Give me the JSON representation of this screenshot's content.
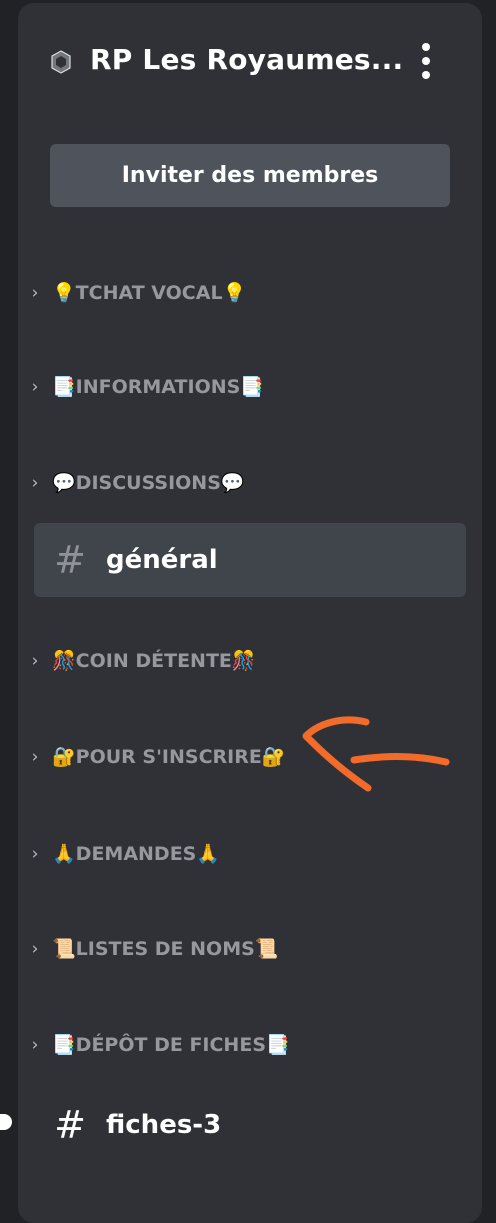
{
  "server": {
    "title": "RP Les Royaumes...",
    "icon": "server-settings-icon",
    "menu_icon": "kebab-menu-icon"
  },
  "invite_button": {
    "label": "Inviter des membres"
  },
  "categories": [
    {
      "emoji_left": "💡",
      "label": "TCHAT VOCAL",
      "emoji_right": "💡"
    },
    {
      "emoji_left": "📑",
      "label": "INFORMATIONS",
      "emoji_right": "📑"
    },
    {
      "emoji_left": "💬",
      "label": "DISCUSSIONS",
      "emoji_right": "💬"
    },
    {
      "emoji_left": "🎊",
      "label": "COIN DÉTENTE",
      "emoji_right": "🎊"
    },
    {
      "emoji_left": "🔐",
      "label": "POUR S'INSCRIRE",
      "emoji_right": "🔐"
    },
    {
      "emoji_left": "🙏",
      "label": "DEMANDES",
      "emoji_right": "🙏"
    },
    {
      "emoji_left": "📜",
      "label": "LISTES DE NOMS",
      "emoji_right": "📜"
    },
    {
      "emoji_left": "📑",
      "label": "DÉPÔT DE FICHES",
      "emoji_right": "📑"
    }
  ],
  "channels": {
    "active": {
      "hash": "#",
      "name": "général"
    },
    "unread": {
      "hash": "#",
      "name": "fiches-3"
    }
  },
  "colors": {
    "background": "#202225",
    "panel": "#2f3136",
    "button": "#4f545c",
    "active_channel": "#40444b",
    "category_text": "#96989d",
    "annotation_arrow": "#f26b2a"
  }
}
